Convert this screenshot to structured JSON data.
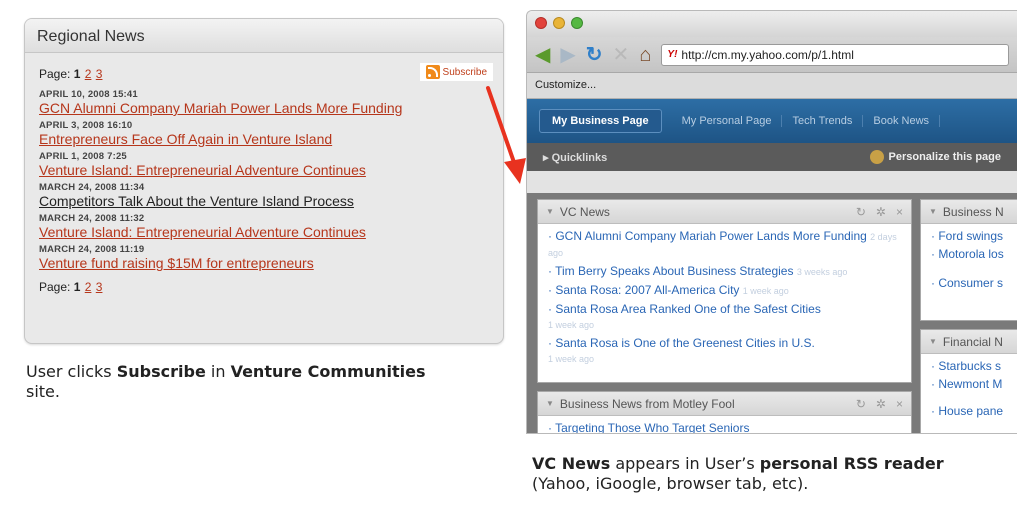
{
  "left_widget": {
    "title": "Regional News",
    "pager_label": "Page:",
    "pages": [
      "1",
      "2",
      "3"
    ],
    "subscribe_label": "Subscribe",
    "items": [
      {
        "date": "APRIL 10, 2008 15:41",
        "title": "GCN Alumni Company Mariah Power Lands More Funding"
      },
      {
        "date": "APRIL 3, 2008 16:10",
        "title": "Entrepreneurs Face Off Again in Venture Island"
      },
      {
        "date": "APRIL 1, 2008 7:25",
        "title": "Venture Island: Entrepreneurial Adventure Continues"
      },
      {
        "date": "MARCH 24, 2008 11:34",
        "title": "Competitors Talk About the Venture Island Process"
      },
      {
        "date": "MARCH 24, 2008 11:32",
        "title": "Venture Island: Entrepreneurial Adventure Continues"
      },
      {
        "date": "MARCH 24, 2008 11:19",
        "title": "Venture fund raising $15M for entrepreneurs"
      }
    ]
  },
  "caption_left": {
    "p1": "User clicks ",
    "b1": "Subscribe",
    "p2": " in ",
    "b2": "Venture Communities",
    "p3": " site."
  },
  "caption_right": {
    "b1": "VC News",
    "p1": " appears in User’s ",
    "b2": "personal RSS reader",
    "p2": " (Yahoo, iGoogle, browser tab, etc)."
  },
  "browser": {
    "url": "http://cm.my.yahoo.com/p/1.html",
    "bookmark_label": "Customize...",
    "tabs": [
      "My Business Page",
      "My Personal Page",
      "Tech Trends",
      "Book News"
    ],
    "quicklinks_label": "Quicklinks",
    "personalize_label": "Personalize this page",
    "vc_news": {
      "title": "VC News",
      "items": [
        {
          "text": "GCN Alumni Company Mariah Power Lands More Funding",
          "age": "2 days ago"
        },
        {
          "text": "Tim Berry Speaks About Business Strategies",
          "age": "3 weeks ago"
        },
        {
          "text": "Santa Rosa: 2007 All-America City",
          "age": "1 week ago"
        },
        {
          "text": "Santa Rosa Area Ranked One of the Safest Cities",
          "age": "1 week ago"
        },
        {
          "text": "Santa Rosa is One of the Greenest Cities in U.S.",
          "age": "1 week ago"
        }
      ]
    },
    "business_mod": {
      "title": "Business N",
      "items": [
        "Ford swings",
        "Motorola los",
        "Consumer s"
      ]
    },
    "financial_mod": {
      "title": "Financial N",
      "items": [
        "Starbucks s",
        "Newmont M",
        "House pane"
      ]
    },
    "motley_mod": {
      "title": "Business News from Motley Fool",
      "items": [
        "Targeting Those Who Target Seniors"
      ]
    }
  },
  "colors": {
    "link_red": "#b6361b",
    "yahoo_blue": "#1e5485",
    "rss_orange": "#f08a1a",
    "arrow_red": "#e8321f"
  }
}
